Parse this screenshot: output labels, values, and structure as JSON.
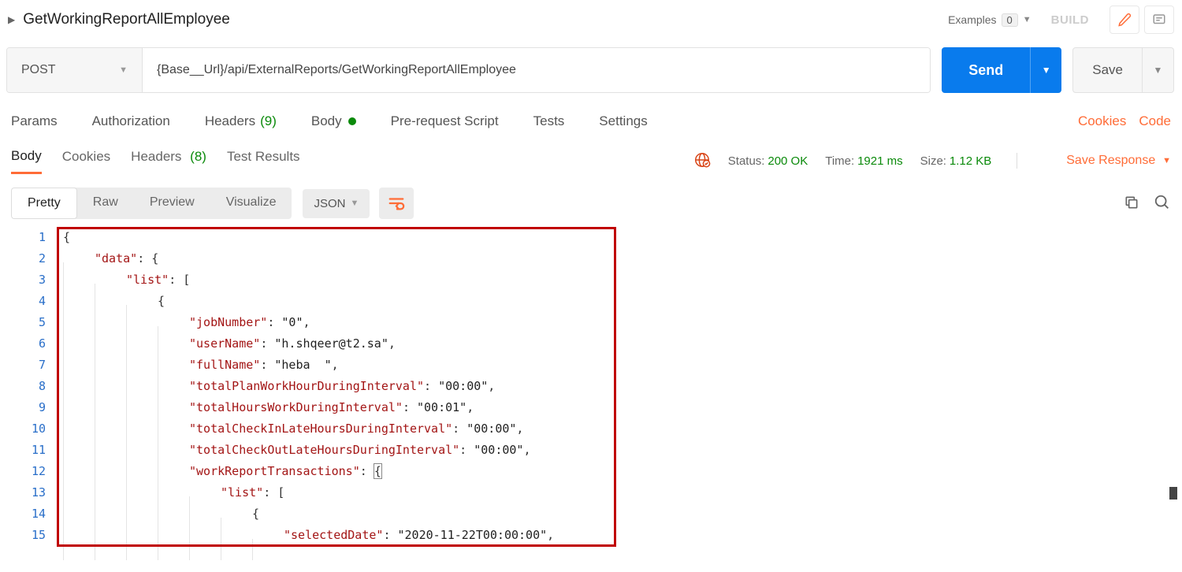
{
  "header": {
    "title": "GetWorkingReportAllEmployee",
    "examples_label": "Examples",
    "examples_count": "0",
    "build_label": "BUILD"
  },
  "request": {
    "method": "POST",
    "url": "{Base__Url}/api/ExternalReports/GetWorkingReportAllEmployee",
    "send_label": "Send",
    "save_label": "Save"
  },
  "req_tabs": {
    "params": "Params",
    "auth": "Authorization",
    "headers": "Headers",
    "headers_count": "(9)",
    "body": "Body",
    "prerequest": "Pre-request Script",
    "tests": "Tests",
    "settings": "Settings",
    "cookies_link": "Cookies",
    "code_link": "Code"
  },
  "resp_tabs": {
    "body": "Body",
    "cookies": "Cookies",
    "headers": "Headers",
    "headers_count": "(8)",
    "test_results": "Test Results"
  },
  "resp_meta": {
    "status_label": "Status:",
    "status_value": "200 OK",
    "time_label": "Time:",
    "time_value": "1921 ms",
    "size_label": "Size:",
    "size_value": "1.12 KB",
    "save_response": "Save Response"
  },
  "view": {
    "pretty": "Pretty",
    "raw": "Raw",
    "preview": "Preview",
    "visualize": "Visualize",
    "format": "JSON"
  },
  "code_lines": [
    "{",
    "    \"data\": {",
    "        \"list\": [",
    "            {",
    "                \"jobNumber\": \"0\",",
    "                \"userName\": \"h.shqeer@t2.sa\",",
    "                \"fullName\": \"heba  \",",
    "                \"totalPlanWorkHourDuringInterval\": \"00:00\",",
    "                \"totalHoursWorkDuringInterval\": \"00:01\",",
    "                \"totalCheckInLateHoursDuringInterval\": \"00:00\",",
    "                \"totalCheckOutLateHoursDuringInterval\": \"00:00\",",
    "                \"workReportTransactions\": {",
    "                    \"list\": [",
    "                        {",
    "                            \"selectedDate\": \"2020-11-22T00:00:00\","
  ]
}
